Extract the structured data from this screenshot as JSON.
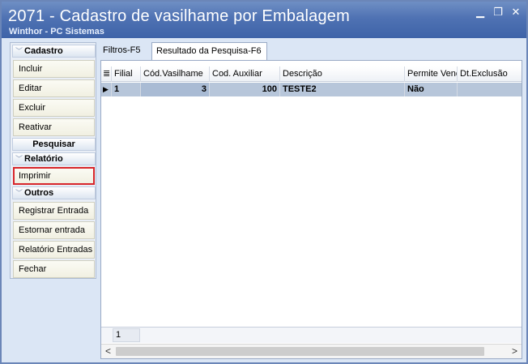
{
  "window": {
    "title": "2071 - Cadastro de vasilhame por Embalagem",
    "subtitle": "Winthor - PC Sistemas",
    "controls": {
      "minimize": "▁",
      "restore": "❐",
      "close": "✕"
    }
  },
  "sidebar": {
    "cadastro": {
      "header": "Cadastro",
      "items": [
        "Incluir",
        "Editar",
        "Excluir",
        "Reativar"
      ]
    },
    "pesquisar_header": "Pesquisar",
    "relatorio": {
      "header": "Relatório",
      "items": [
        "Imprimir"
      ]
    },
    "outros": {
      "header": "Outros",
      "items": [
        "Registrar Entrada",
        "Estornar entrada",
        "Relatório Entradas",
        "Fechar"
      ]
    },
    "chevron_icon": "double-chevron-down-icon"
  },
  "tabs": [
    {
      "label": "Filtros-F5",
      "active": false
    },
    {
      "label": "Resultado da Pesquisa-F6",
      "active": true
    }
  ],
  "grid": {
    "indicator_icon": "≣",
    "columns": [
      "Filial",
      "Cód.Vasilhame",
      "Cod. Auxiliar",
      "Descrição",
      "Permite Venda",
      "Dt.Exclusão"
    ],
    "rows": [
      {
        "indicator": "▶",
        "filial": "1",
        "cod_vasilhame": "3",
        "cod_auxiliar": "100",
        "descricao": "TESTE2",
        "permite_venda": "Não",
        "dt_exclusao": ""
      }
    ],
    "footer_count": "1"
  },
  "scroll": {
    "left": "<",
    "right": ">"
  },
  "colors": {
    "title_bar": "#4f72b3",
    "selected_row": "#b7c6da",
    "highlight_border": "#d8262b"
  }
}
